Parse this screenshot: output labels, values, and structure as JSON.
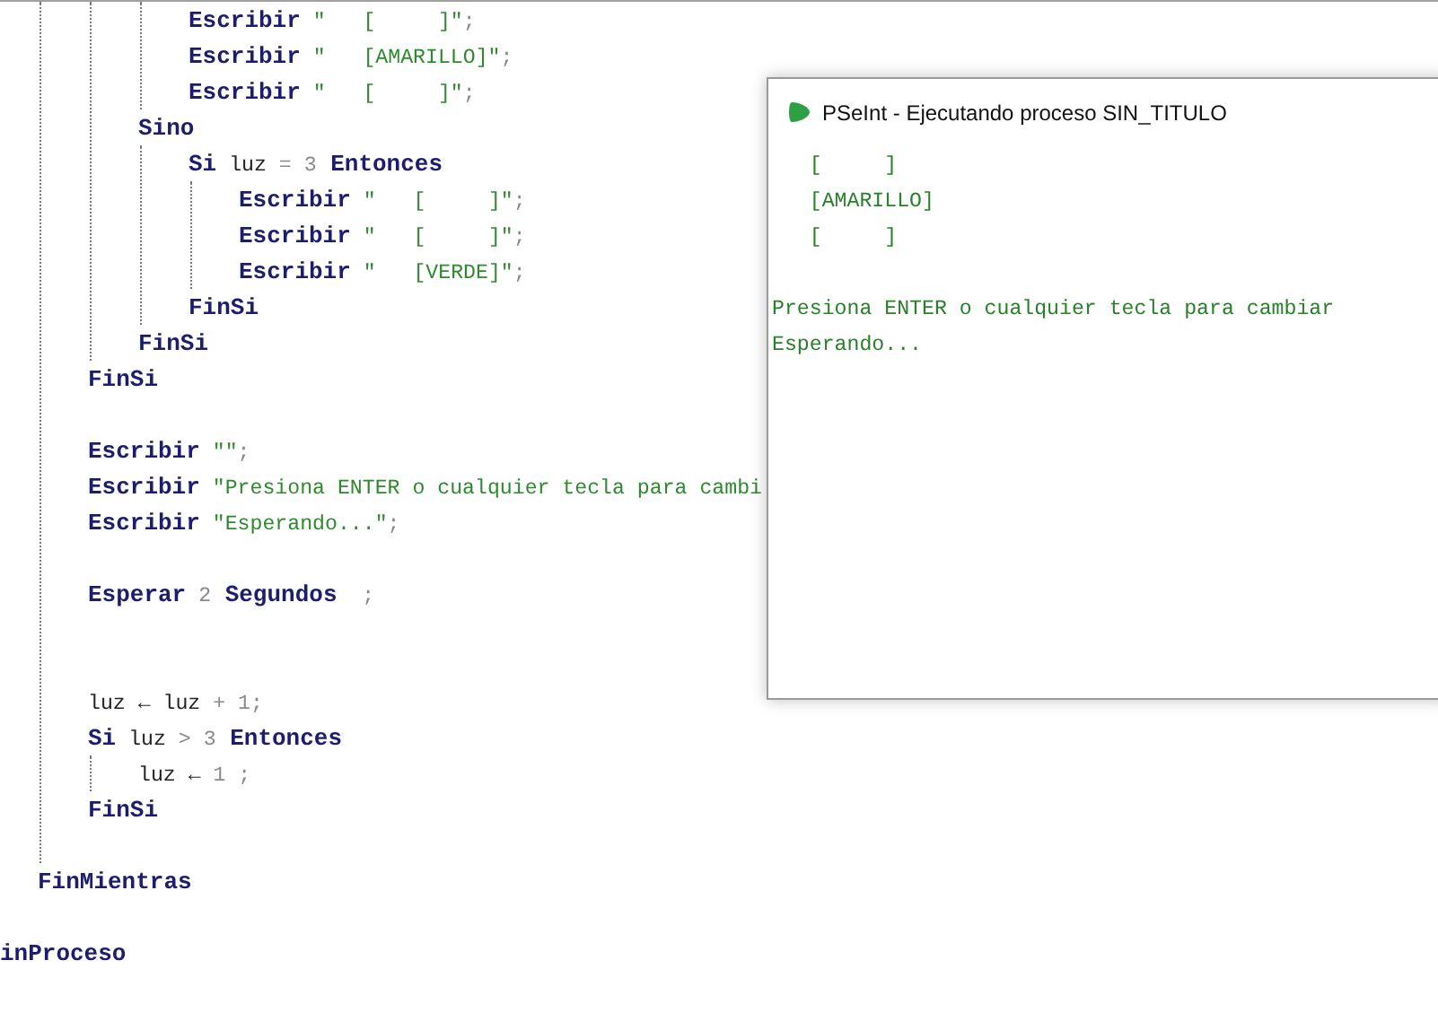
{
  "editor": {
    "lines": [
      {
        "kind": "block",
        "children": [
          {
            "kind": "block",
            "children": [
              {
                "kind": "block",
                "children": [
                  {
                    "kind": "block",
                    "children": [
                      {
                        "kind": "code",
                        "tokens": [
                          {
                            "kind": "keyword",
                            "text": "Escribir"
                          },
                          {
                            "kind": "string",
                            "text": " \"   [     ]\""
                          },
                          {
                            "kind": "punct",
                            "text": ";"
                          }
                        ]
                      },
                      {
                        "kind": "code",
                        "tokens": [
                          {
                            "kind": "keyword",
                            "text": "Escribir"
                          },
                          {
                            "kind": "string",
                            "text": " \"   [AMARILLO]\""
                          },
                          {
                            "kind": "punct",
                            "text": ";"
                          }
                        ]
                      },
                      {
                        "kind": "code",
                        "tokens": [
                          {
                            "kind": "keyword",
                            "text": "Escribir"
                          },
                          {
                            "kind": "string",
                            "text": " \"   [     ]\""
                          },
                          {
                            "kind": "punct",
                            "text": ";"
                          }
                        ]
                      }
                    ]
                  },
                  {
                    "kind": "code",
                    "tokens": [
                      {
                        "kind": "keyword",
                        "text": "Sino"
                      }
                    ],
                    "children": [
                      {
                        "kind": "code",
                        "tokens": [
                          {
                            "kind": "keyword",
                            "text": "Si"
                          },
                          {
                            "kind": "name",
                            "text": " luz"
                          },
                          {
                            "kind": "operator",
                            "text": " ="
                          },
                          {
                            "kind": "number",
                            "text": " 3"
                          },
                          {
                            "kind": "keyword",
                            "text": " Entonces"
                          }
                        ],
                        "children": [
                          {
                            "kind": "code",
                            "tokens": [
                              {
                                "kind": "keyword",
                                "text": "Escribir"
                              },
                              {
                                "kind": "string",
                                "text": " \"   [     ]\""
                              },
                              {
                                "kind": "punct",
                                "text": ";"
                              }
                            ]
                          },
                          {
                            "kind": "code",
                            "tokens": [
                              {
                                "kind": "keyword",
                                "text": "Escribir"
                              },
                              {
                                "kind": "string",
                                "text": " \"   [     ]\""
                              },
                              {
                                "kind": "punct",
                                "text": ";"
                              }
                            ]
                          },
                          {
                            "kind": "code",
                            "tokens": [
                              {
                                "kind": "keyword",
                                "text": "Escribir"
                              },
                              {
                                "kind": "string",
                                "text": " \"   [VERDE]\""
                              },
                              {
                                "kind": "punct",
                                "text": ";"
                              }
                            ]
                          }
                        ]
                      },
                      {
                        "kind": "code",
                        "tokens": [
                          {
                            "kind": "keyword",
                            "text": "FinSi"
                          }
                        ]
                      }
                    ]
                  },
                  {
                    "kind": "code",
                    "tokens": [
                      {
                        "kind": "keyword",
                        "text": "FinSi"
                      }
                    ]
                  }
                ]
              },
              {
                "kind": "code",
                "tokens": [
                  {
                    "kind": "keyword",
                    "text": "FinSi"
                  }
                ]
              },
              {
                "kind": "blank"
              },
              {
                "kind": "code",
                "tokens": [
                  {
                    "kind": "keyword",
                    "text": "Escribir"
                  },
                  {
                    "kind": "string",
                    "text": " \"\""
                  },
                  {
                    "kind": "punct",
                    "text": ";"
                  }
                ]
              },
              {
                "kind": "code",
                "tokens": [
                  {
                    "kind": "keyword",
                    "text": "Escribir"
                  },
                  {
                    "kind": "string",
                    "text": " \"Presiona ENTER o cualquier tecla para cambi"
                  }
                ]
              },
              {
                "kind": "code",
                "tokens": [
                  {
                    "kind": "keyword",
                    "text": "Escribir"
                  },
                  {
                    "kind": "string",
                    "text": " \"Esperando...\""
                  },
                  {
                    "kind": "punct",
                    "text": ";"
                  }
                ]
              },
              {
                "kind": "blank"
              },
              {
                "kind": "code",
                "tokens": [
                  {
                    "kind": "keyword",
                    "text": "Esperar"
                  },
                  {
                    "kind": "number",
                    "text": " 2"
                  },
                  {
                    "kind": "keyword",
                    "text": " Segundos"
                  },
                  {
                    "kind": "punct",
                    "text": "  ;"
                  }
                ]
              },
              {
                "kind": "blank"
              },
              {
                "kind": "blank"
              },
              {
                "kind": "code",
                "tokens": [
                  {
                    "kind": "name",
                    "text": "luz"
                  },
                  {
                    "kind": "name",
                    "text": " ←"
                  },
                  {
                    "kind": "name",
                    "text": " luz"
                  },
                  {
                    "kind": "operator",
                    "text": " +"
                  },
                  {
                    "kind": "number",
                    "text": " 1"
                  },
                  {
                    "kind": "punct",
                    "text": ";"
                  }
                ]
              },
              {
                "kind": "code",
                "tokens": [
                  {
                    "kind": "keyword",
                    "text": "Si"
                  },
                  {
                    "kind": "name",
                    "text": " luz"
                  },
                  {
                    "kind": "operator",
                    "text": " >"
                  },
                  {
                    "kind": "number",
                    "text": " 3"
                  },
                  {
                    "kind": "keyword",
                    "text": " Entonces"
                  }
                ],
                "children": [
                  {
                    "kind": "code",
                    "tokens": [
                      {
                        "kind": "name",
                        "text": "luz"
                      },
                      {
                        "kind": "name",
                        "text": " ←"
                      },
                      {
                        "kind": "number",
                        "text": " 1"
                      },
                      {
                        "kind": "punct",
                        "text": " ;"
                      }
                    ]
                  }
                ]
              },
              {
                "kind": "code",
                "tokens": [
                  {
                    "kind": "keyword",
                    "text": "FinSi"
                  }
                ]
              },
              {
                "kind": "blank"
              }
            ]
          },
          {
            "kind": "code",
            "tokens": [
              {
                "kind": "keyword",
                "text": "FinMientras"
              }
            ]
          },
          {
            "kind": "blank"
          }
        ]
      },
      {
        "kind": "code",
        "tokens": [
          {
            "kind": "keyword",
            "text": "inProceso"
          }
        ]
      }
    ]
  },
  "run_window": {
    "title": "PSeInt - Ejecutando proceso SIN_TITULO",
    "lines": [
      {
        "kind": "text",
        "text": "   [     ]"
      },
      {
        "kind": "text",
        "text": "   [AMARILLO]"
      },
      {
        "kind": "text",
        "text": "   [     ]"
      },
      {
        "kind": "blank"
      },
      {
        "kind": "text",
        "text": "Presiona ENTER o cualquier tecla para cambiar"
      },
      {
        "kind": "text",
        "text": "Esperando..."
      }
    ]
  }
}
